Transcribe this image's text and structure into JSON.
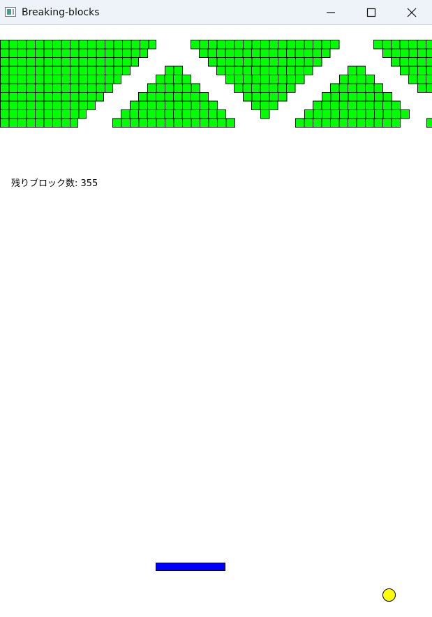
{
  "window": {
    "title": "Breaking-blocks",
    "icon": "app-window-icon",
    "controls": [
      "minimize-icon",
      "maximize-icon",
      "close-icon"
    ]
  },
  "hud": {
    "label": "残りブロック数: ",
    "remaining_blocks": 355
  },
  "colors": {
    "block": "#00ff00",
    "block_border": "#000000",
    "paddle": "#0000ff",
    "ball": "#ffff00",
    "background": "#ffffff"
  }
}
